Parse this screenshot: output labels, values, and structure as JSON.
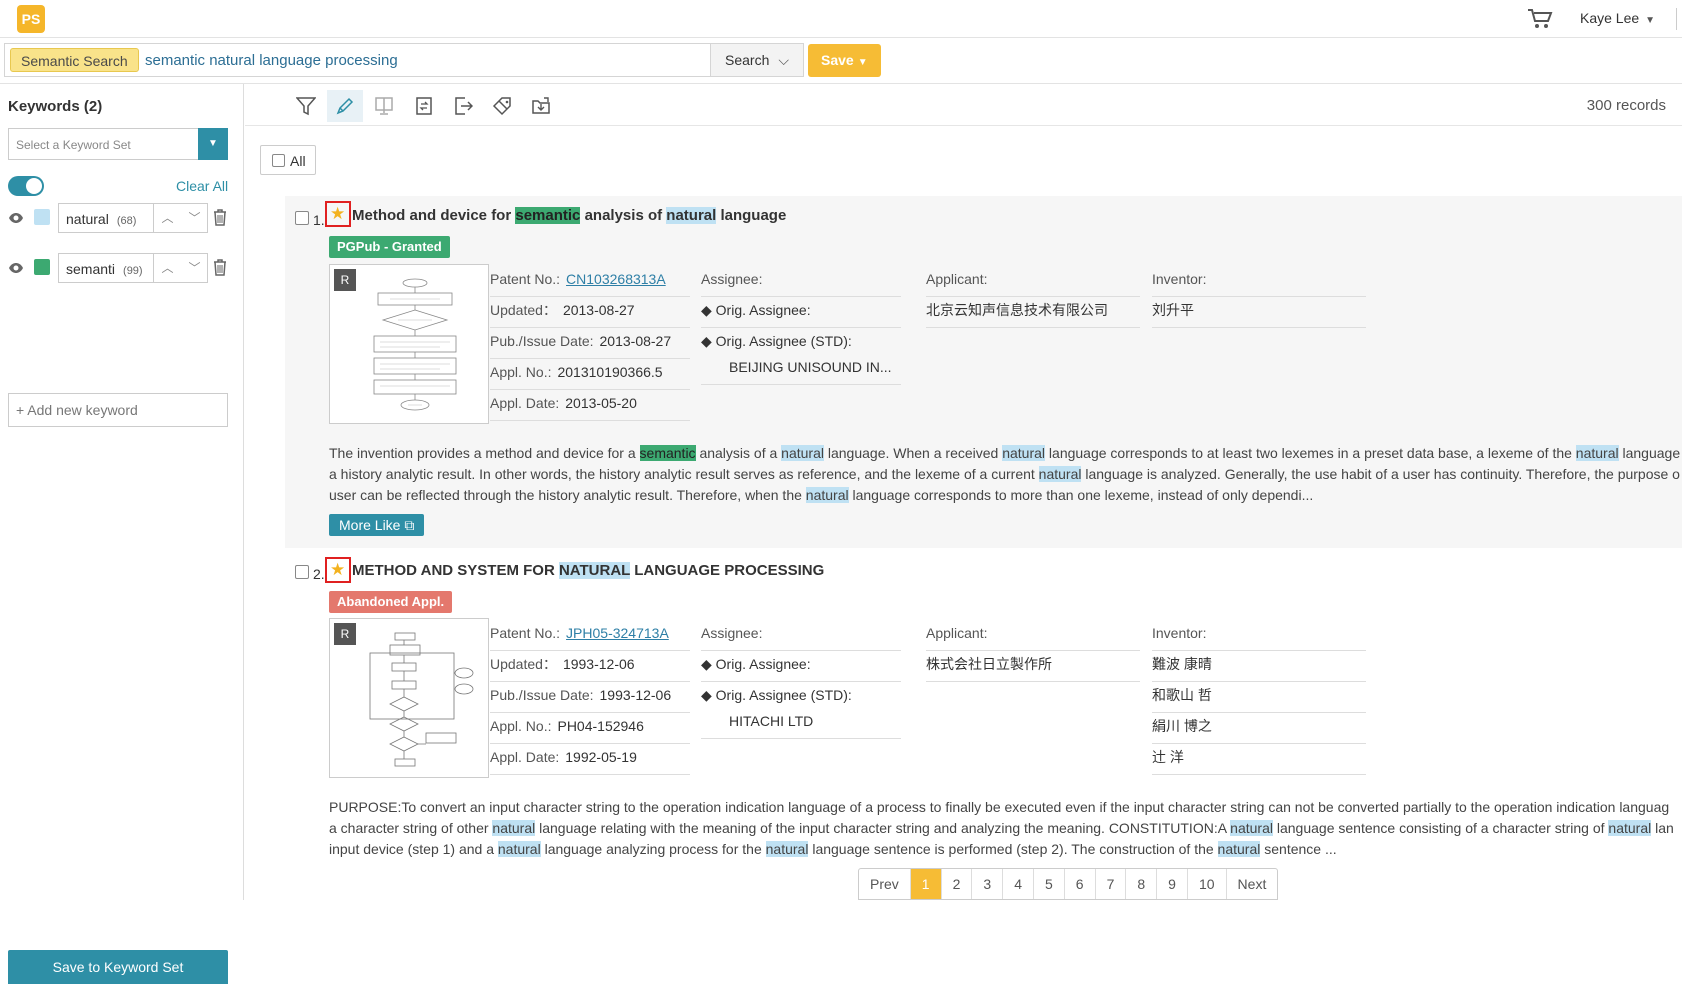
{
  "header": {
    "logo_text": "PS",
    "user_name": "Kaye Lee",
    "cart_icon": "cart-icon"
  },
  "search": {
    "mode_tag": "Semantic Search",
    "query": "semantic natural language processing",
    "search_label": "Search",
    "save_label": "Save"
  },
  "sidebar": {
    "title": "Keywords (2)",
    "select_placeholder": "Select a Keyword Set",
    "clear_all": "Clear All",
    "keywords": [
      {
        "word": "natural",
        "count": "(68)",
        "color": "#bfe1f3"
      },
      {
        "word": "semanti",
        "count": "(99)",
        "color": "#3ca971"
      }
    ],
    "add_placeholder": "+ Add new keyword",
    "save_set": "Save to Keyword Set"
  },
  "toolbar": {
    "records": "300 records",
    "all_label": "All"
  },
  "results": [
    {
      "num": "1.",
      "title_parts": [
        {
          "t": "Method and device for ",
          "h": ""
        },
        {
          "t": "semantic",
          "h": "g"
        },
        {
          "t": " analysis of ",
          "h": ""
        },
        {
          "t": "natural",
          "h": "b"
        },
        {
          "t": " language",
          "h": ""
        }
      ],
      "status": "PGPub - Granted",
      "patent_no_label": "Patent No.:",
      "patent_no": "CN103268313A",
      "updated_label": "Updated：",
      "updated": "2013-08-27",
      "pub_label": "Pub./Issue Date:",
      "pub": "2013-08-27",
      "appl_no_label": "Appl. No.:",
      "appl_no": "201310190366.5",
      "appl_date_label": "Appl. Date:",
      "appl_date": "2013-05-20",
      "assignee_label": "Assignee:",
      "orig_assignee_label": "◆ Orig. Assignee:",
      "orig_assignee_std_label": "◆ Orig. Assignee (STD):",
      "orig_assignee_std": "BEIJING UNISOUND IN...",
      "applicant_label": "Applicant:",
      "applicant": "北京云知声信息技术有限公司",
      "inventor_label": "Inventor:",
      "inventors": [
        "刘升平"
      ],
      "abstract_lines": [
        [
          {
            "t": "The invention provides a method and device for a ",
            "h": ""
          },
          {
            "t": "semantic",
            "h": "g"
          },
          {
            "t": " analysis of a ",
            "h": ""
          },
          {
            "t": "natural",
            "h": "b"
          },
          {
            "t": " language. When a received ",
            "h": ""
          },
          {
            "t": "natural",
            "h": "b"
          },
          {
            "t": " language corresponds to at least two lexemes in a preset data base, a lexeme of the ",
            "h": ""
          },
          {
            "t": "natural",
            "h": "b"
          },
          {
            "t": " language",
            "h": ""
          }
        ],
        [
          {
            "t": "a history analytic result. In other words, the history analytic result serves as reference, and the lexeme of a current ",
            "h": ""
          },
          {
            "t": "natural",
            "h": "b"
          },
          {
            "t": " language is analyzed. Generally, the use habit of a user has continuity. Therefore, the purpose o",
            "h": ""
          }
        ],
        [
          {
            "t": "user can be reflected through the history analytic result. Therefore, when the ",
            "h": ""
          },
          {
            "t": "natural",
            "h": "b"
          },
          {
            "t": " language corresponds to more than one lexeme, instead of only dependi...",
            "h": ""
          }
        ]
      ],
      "more_like": "More Like"
    },
    {
      "num": "2.",
      "title_parts": [
        {
          "t": "METHOD AND SYSTEM FOR ",
          "h": ""
        },
        {
          "t": "NATURAL",
          "h": "b"
        },
        {
          "t": " LANGUAGE PROCESSING",
          "h": ""
        }
      ],
      "status": "Abandoned Appl.",
      "patent_no_label": "Patent No.:",
      "patent_no": "JPH05-324713A",
      "updated_label": "Updated：",
      "updated": "1993-12-06",
      "pub_label": "Pub./Issue Date:",
      "pub": "1993-12-06",
      "appl_no_label": "Appl. No.:",
      "appl_no": "PH04-152946",
      "appl_date_label": "Appl. Date:",
      "appl_date": "1992-05-19",
      "assignee_label": "Assignee:",
      "orig_assignee_label": "◆ Orig. Assignee:",
      "orig_assignee_std_label": "◆ Orig. Assignee (STD):",
      "orig_assignee_std": "HITACHI LTD",
      "applicant_label": "Applicant:",
      "applicant": "株式会社日立製作所",
      "inventor_label": "Inventor:",
      "inventors": [
        "難波 康晴",
        "和歌山 哲",
        "絹川 博之",
        "辻 洋"
      ],
      "abstract_lines": [
        [
          {
            "t": "PURPOSE:To convert an input character string to the operation indication language of a process to finally be executed even if the input character string can not be converted partially to the operation indication languag",
            "h": ""
          }
        ],
        [
          {
            "t": "a character string of other ",
            "h": ""
          },
          {
            "t": "natural",
            "h": "b"
          },
          {
            "t": " language relating with the meaning of the input character string and analyzing the meaning. CONSTITUTION:A ",
            "h": ""
          },
          {
            "t": "natural",
            "h": "b"
          },
          {
            "t": " language sentence consisting of a character string of ",
            "h": ""
          },
          {
            "t": "natural",
            "h": "b"
          },
          {
            "t": " lan",
            "h": ""
          }
        ],
        [
          {
            "t": "input device (step 1) and a ",
            "h": ""
          },
          {
            "t": "natural",
            "h": "b"
          },
          {
            "t": " language analyzing process for the ",
            "h": ""
          },
          {
            "t": "natural",
            "h": "b"
          },
          {
            "t": " language sentence is performed (step 2). The construction of the ",
            "h": ""
          },
          {
            "t": "natural",
            "h": "b"
          },
          {
            "t": " sentence ...",
            "h": ""
          }
        ]
      ]
    }
  ],
  "pager": {
    "prev": "Prev",
    "pages": [
      "1",
      "2",
      "3",
      "4",
      "5",
      "6",
      "7",
      "8",
      "9",
      "10"
    ],
    "current": "1",
    "next": "Next"
  }
}
